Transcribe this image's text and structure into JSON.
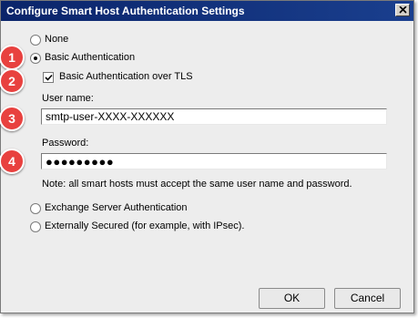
{
  "window": {
    "title": "Configure Smart Host Authentication Settings",
    "close_glyph": "close-icon"
  },
  "options": {
    "none": {
      "label": "None",
      "checked": false
    },
    "basic": {
      "label": "Basic Authentication",
      "checked": true
    },
    "tls": {
      "label": "Basic Authentication over TLS",
      "checked": true
    },
    "exchange": {
      "label": "Exchange Server Authentication",
      "checked": false
    },
    "external": {
      "label": "Externally Secured (for example, with IPsec).",
      "checked": false
    }
  },
  "fields": {
    "username_label": "User name:",
    "username_value": "smtp-user-XXXX-XXXXXX",
    "password_label": "Password:",
    "password_value": "●●●●●●●●●"
  },
  "note": "Note: all smart hosts must accept the same user name and password.",
  "badges": [
    "1",
    "2",
    "3",
    "4"
  ],
  "buttons": {
    "ok": "OK",
    "cancel": "Cancel"
  },
  "colors": {
    "titlebar": "#0a246a",
    "badge": "#e8413f",
    "dialog_bg": "#ededed"
  }
}
